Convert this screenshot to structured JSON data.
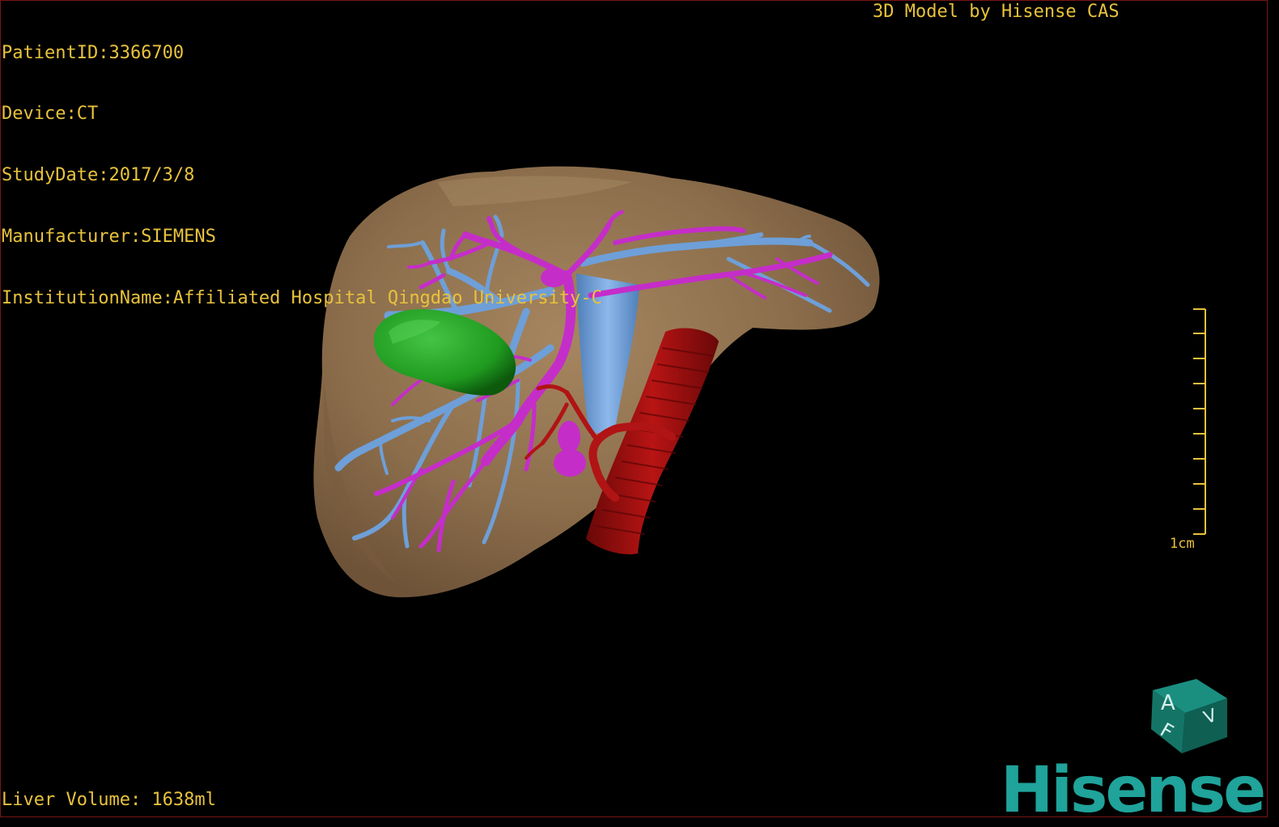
{
  "overlay": {
    "patient_id": "PatientID:3366700",
    "device": "Device:CT",
    "study_date": "StudyDate:2017/3/8",
    "manufacturer": "Manufacturer:SIEMENS",
    "institution": "InstitutionName:Affiliated Hospital Qingdao University-C",
    "model_credit": "3D Model by Hisense CAS",
    "liver_volume": "Liver Volume: 1638ml"
  },
  "scale_bar": {
    "label": "1cm",
    "ticks": 10
  },
  "orientation_cube": {
    "face_letters": [
      "A",
      "F",
      "V"
    ]
  },
  "logo": {
    "text": "Hisense"
  },
  "colors": {
    "text_overlay": "#e8c23c",
    "liver": "#8c6e4c",
    "portal_vein": "#6e9fd8",
    "hepatic_vein": "#c52dc9",
    "artery_aorta": "#9c1010",
    "tumor": "#1f9a1f",
    "logo": "#1fa39a",
    "frame": "#7a1515"
  },
  "icons": [
    "orientation-cube-icon",
    "scale-bar-icon",
    "hisense-logo"
  ]
}
